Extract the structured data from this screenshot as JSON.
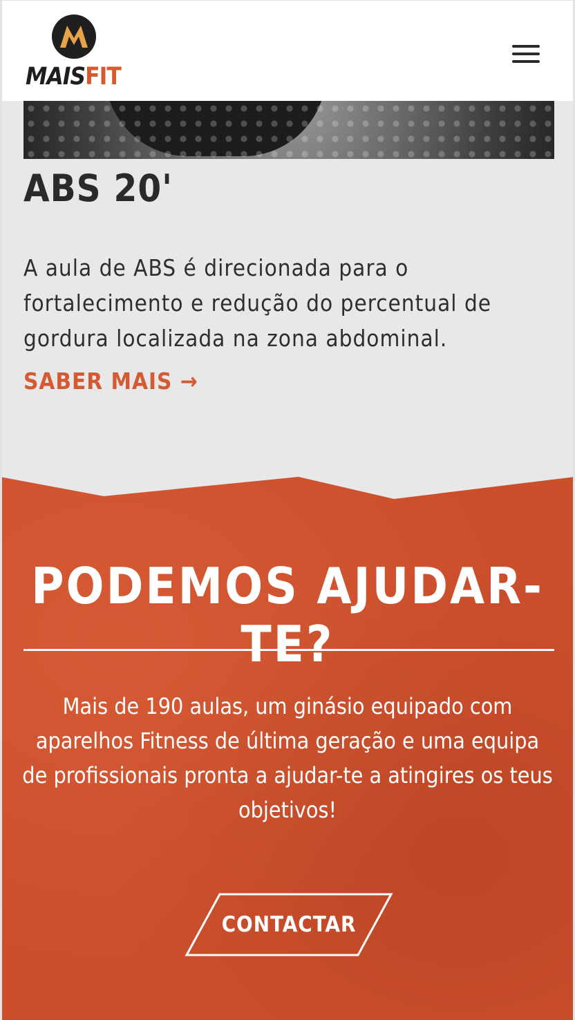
{
  "header": {
    "brand_mais": "MAIS",
    "brand_fit": "FIT",
    "menu_icon": "hamburger-icon"
  },
  "class_card": {
    "title": "ABS 20'",
    "description": "A aula de ABS é direcionada para o fortalecimento e redução do percentual de gordura localizada na zona abdominal.",
    "link_label": "SABER MAIS →"
  },
  "cta": {
    "title": "PODEMOS AJUDAR-TE?",
    "text": "Mais de 190 aulas, um ginásio equipado com aparelhos Fitness de última geração e uma equipa de profissionais pronta a ajudar-te a atingires os teus objetivos!",
    "button_label": "CONTACTAR"
  },
  "colors": {
    "accent": "#d45a33",
    "section_background": "#cc4f2c",
    "page_background": "#e9e8e8"
  }
}
